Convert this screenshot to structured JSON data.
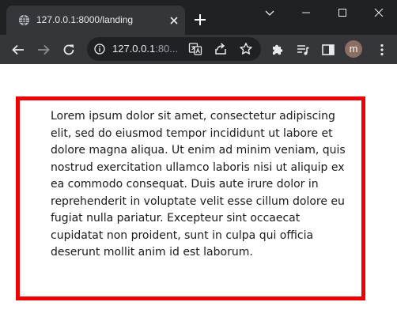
{
  "tab": {
    "title": "127.0.0.1:8000/landing",
    "favicon": "globe-icon"
  },
  "omnibox": {
    "url_host": "127.0.0.1",
    "url_rest": ":80..."
  },
  "profile": {
    "initial": "m",
    "color": "#8d6e63"
  },
  "page": {
    "paragraph": "Lorem ipsum dolor sit amet, consectetur adipiscing elit, sed do eiusmod tempor incididunt ut labore et dolore magna aliqua. Ut enim ad minim veniam, quis nostrud exercitation ullamco laboris nisi ut aliquip ex ea commodo consequat. Duis aute irure dolor in reprehenderit in voluptate velit esse cillum dolore eu fugiat nulla pariatur. Excepteur sint occaecat cupidatat non proident, sunt in culpa qui officia deserunt mollit anim id est laborum.",
    "border_color": "#ee0000"
  },
  "icons": {
    "back": "back-arrow-icon",
    "forward": "forward-arrow-icon",
    "reload": "reload-icon",
    "info": "info-icon",
    "translate": "translate-icon",
    "share": "share-icon",
    "bookmark": "star-icon",
    "extensions": "puzzle-icon",
    "media": "media-control-icon",
    "side_panel": "side-panel-icon",
    "menu": "kebab-menu-icon"
  }
}
